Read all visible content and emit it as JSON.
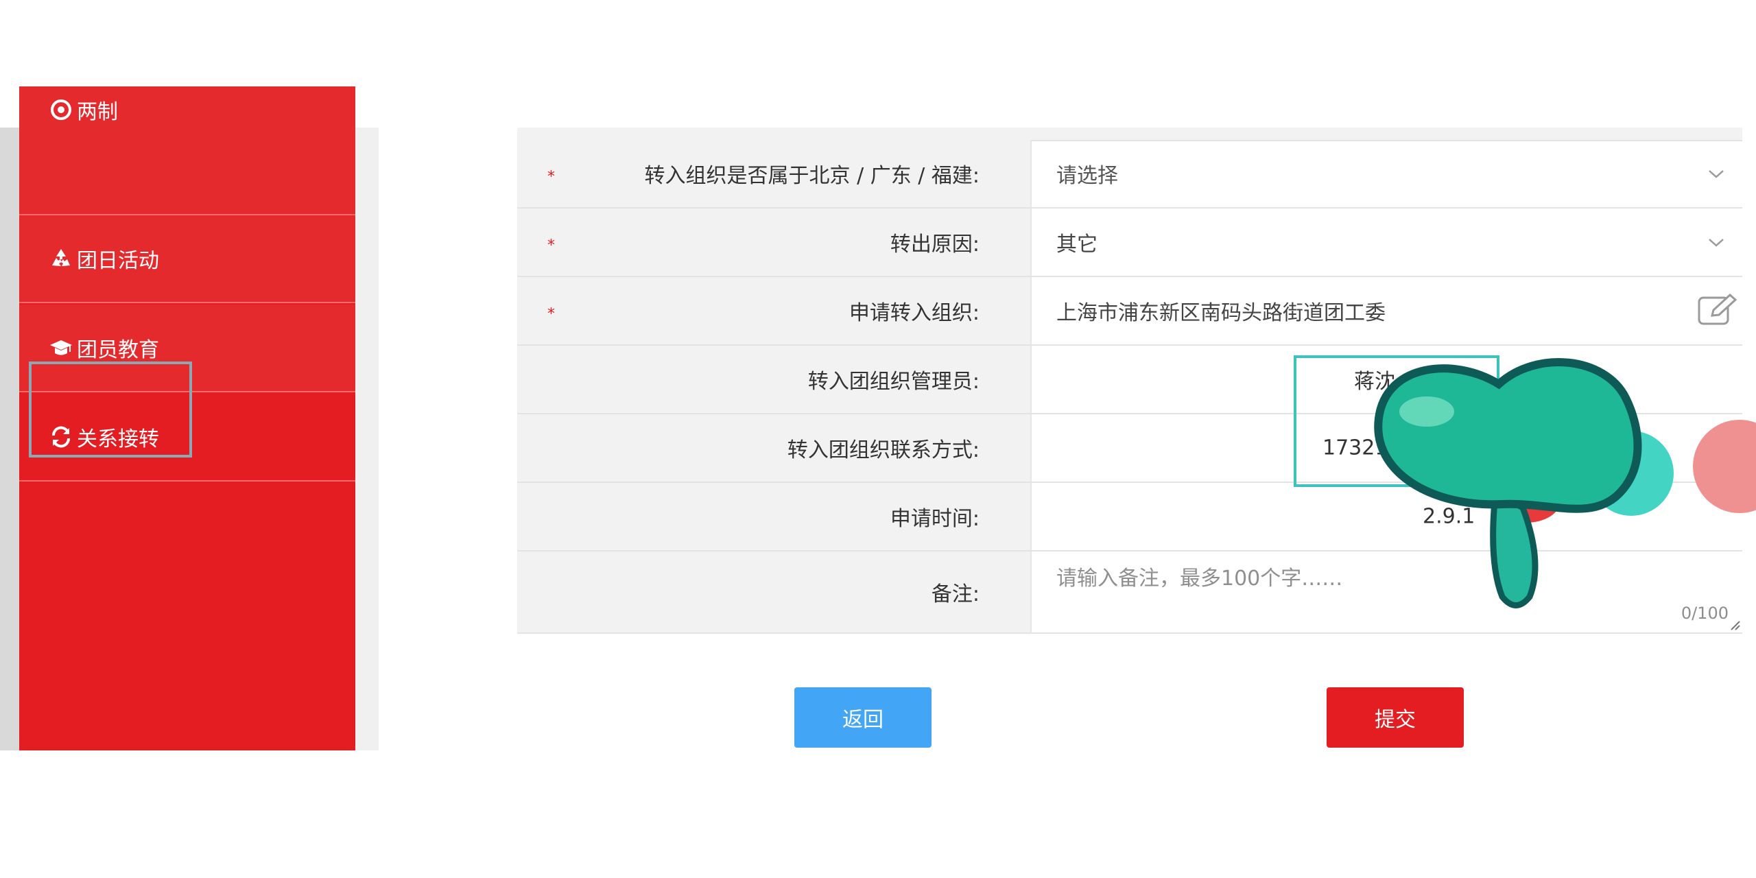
{
  "sidebar": {
    "items": [
      {
        "label": "两制",
        "icon": "target-icon"
      },
      {
        "label": "团日活动",
        "icon": "recycle-icon"
      },
      {
        "label": "团员教育",
        "icon": "graduation-cap-icon"
      },
      {
        "label": "关系接转",
        "icon": "refresh-icon"
      }
    ]
  },
  "form": {
    "rows": [
      {
        "label": "转入组织是否属于北京 / 广东 / 福建:",
        "required": "*",
        "value": "请选择",
        "type": "select"
      },
      {
        "label": "转出原因:",
        "required": "*",
        "value": "其它",
        "type": "select"
      },
      {
        "label": "申请转入组织:",
        "required": "*",
        "value": "上海市浦东新区南码头路街道团工委",
        "type": "picker"
      },
      {
        "label": "转入团组织管理员:",
        "value": "蒋沈",
        "type": "text"
      },
      {
        "label": "转入团组织联系方式:",
        "value": "17321",
        "type": "text"
      },
      {
        "label": "申请时间:",
        "value": "2.9.1",
        "type": "text"
      },
      {
        "label": "备注:",
        "placeholder": "请输入备注，最多100个字……",
        "counter": "0/100",
        "type": "textarea"
      }
    ]
  },
  "buttons": {
    "back": "返回",
    "submit": "提交"
  },
  "colors": {
    "brand_red": "#e31d22",
    "back_blue": "#42a5f5",
    "highlight_teal": "#3cc3be"
  }
}
